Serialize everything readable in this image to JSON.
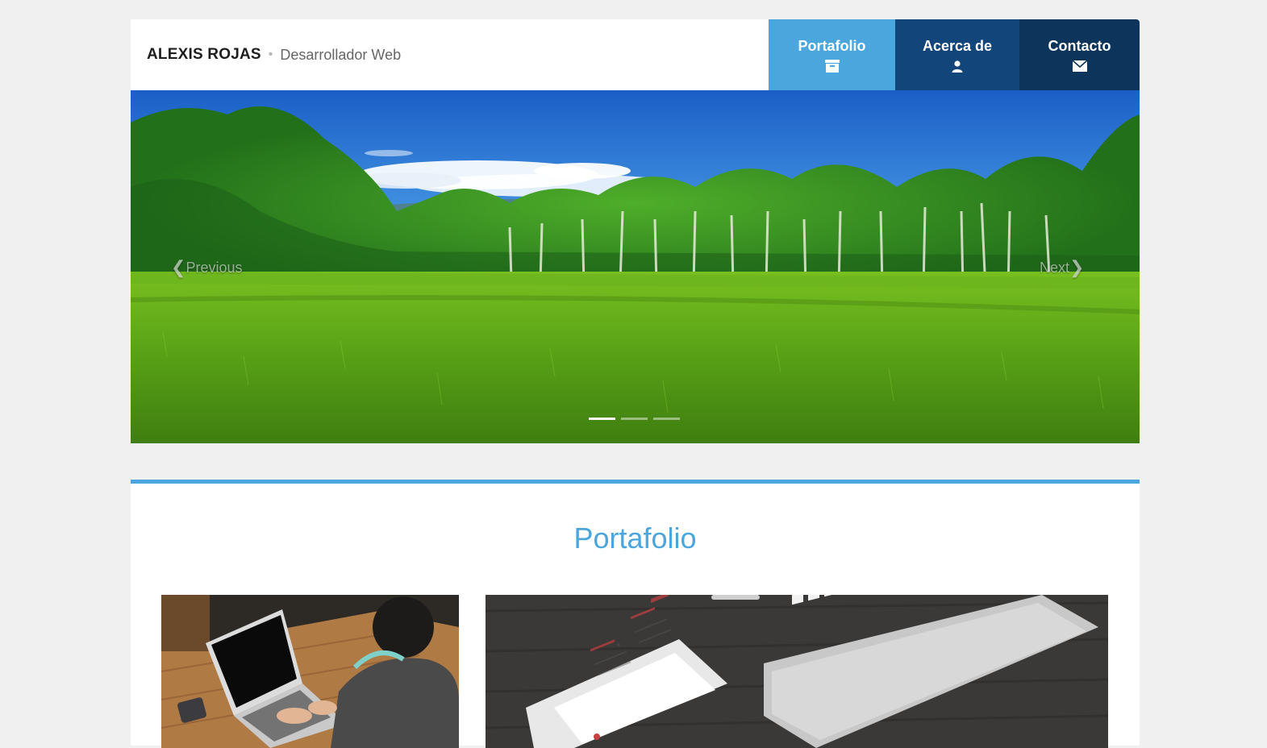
{
  "header": {
    "brand_name": "ALEXIS ROJAS",
    "separator": "•",
    "role": "Desarrollador Web"
  },
  "nav": [
    {
      "label": "Portafolio",
      "icon": "archive-icon",
      "color": "#4aa6dd"
    },
    {
      "label": "Acerca de",
      "icon": "user-icon",
      "color": "#12457a"
    },
    {
      "label": "Contacto",
      "icon": "envelope-icon",
      "color": "#0d355b"
    }
  ],
  "slider": {
    "prev_label": "Previous",
    "next_label": "Next",
    "indicators": 3,
    "active_index": 0
  },
  "portfolio": {
    "title": "Portafolio",
    "accent": "#4aa6dd"
  },
  "colors": {
    "background": "#f0f0f0",
    "accent": "#4aa6dd"
  }
}
